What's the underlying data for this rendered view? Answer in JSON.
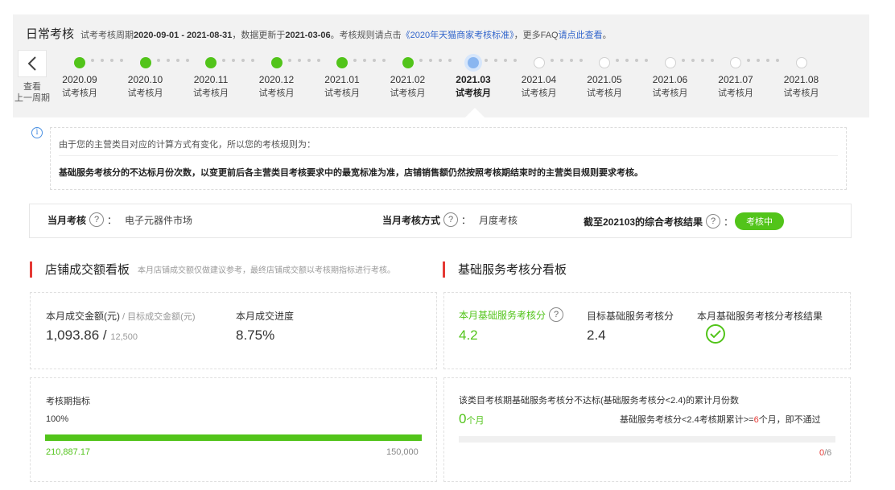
{
  "header": {
    "title": "日常考核",
    "info_prefix": "试考考核周期",
    "period": "2020-09-01 - 2021-08-31",
    "info_mid": "，数据更新于",
    "updated": "2021-03-06",
    "info_mid2": "。考核规则请点击",
    "rule_link": "《2020年天猫商家考核标准》",
    "info_mid3": "，更多FAQ",
    "faq_link": "请点此查看",
    "info_end": "。"
  },
  "back": {
    "label1": "查看",
    "label2": "上一周期",
    "icon": "chevron-left-icon"
  },
  "timeline": [
    {
      "date": "2020.09",
      "sub": "试考核月",
      "state": "done"
    },
    {
      "date": "2020.10",
      "sub": "试考核月",
      "state": "done"
    },
    {
      "date": "2020.11",
      "sub": "试考核月",
      "state": "done"
    },
    {
      "date": "2020.12",
      "sub": "试考核月",
      "state": "done"
    },
    {
      "date": "2021.01",
      "sub": "试考核月",
      "state": "done"
    },
    {
      "date": "2021.02",
      "sub": "试考核月",
      "state": "done"
    },
    {
      "date": "2021.03",
      "sub": "试考核月",
      "state": "current"
    },
    {
      "date": "2021.04",
      "sub": "试考核月",
      "state": "todo"
    },
    {
      "date": "2021.05",
      "sub": "试考核月",
      "state": "todo"
    },
    {
      "date": "2021.06",
      "sub": "试考核月",
      "state": "todo"
    },
    {
      "date": "2021.07",
      "sub": "试考核月",
      "state": "todo"
    },
    {
      "date": "2021.08",
      "sub": "试考核月",
      "state": "todo"
    }
  ],
  "notice": {
    "line1": "由于您的主营类目对应的计算方式有变化，所以您的考核规则为：",
    "line2": "基础服务考核分的不达标月份次数，以变更前后各主营类目考核要求中的最宽标准为准，店铺销售额仍然按照考核期结束时的主营类目规则要求考核。"
  },
  "summary": {
    "month_label": "当月考核",
    "month_value": "电子元器件市场",
    "method_label": "当月考核方式",
    "method_value": "月度考核",
    "result_label": "截至202103的综合考核结果",
    "result_value": "考核中",
    "colon": "："
  },
  "left_section": {
    "title": "店铺成交额看板",
    "hint": "本月店铺成交额仅做建议参考，最终店铺成交额以考核期指标进行考核。",
    "amount_label": "本月成交金额(元)",
    "target_label": " / 目标成交金额(元)",
    "amount_value": "1,093.86",
    "slash": " / ",
    "target_value": "12,500",
    "progress_label": "本月成交进度",
    "progress_value": "8.75%",
    "period_label": "考核期指标",
    "period_percent": "100%",
    "period_progress": 1.0,
    "period_current": "210,887.17",
    "period_target": "150,000"
  },
  "right_section": {
    "title": "基础服务考核分看板",
    "score_label": "本月基础服务考核分",
    "score_value": "4.2",
    "target_label": "目标基础服务考核分",
    "target_value": "2.4",
    "result_label": "本月基础服务考核分考核结果",
    "result_icon": "check-circle-icon",
    "fail_title": "该类目考核期基础服务考核分不达标(基础服务考核分<2.4)的累计月份数",
    "fail_count": "0",
    "fail_unit": "个月",
    "fail_rule_pre": "基础服务考核分<2.4考核期累计>=",
    "fail_rule_num": "6",
    "fail_rule_post": "个月，即不通过",
    "fail_progress": 0,
    "fail_current": "0",
    "fail_total": "/6"
  },
  "colors": {
    "green": "#52c41a",
    "red": "#e53935",
    "link": "#3366cc",
    "current_dot": "#8ab6f0"
  }
}
